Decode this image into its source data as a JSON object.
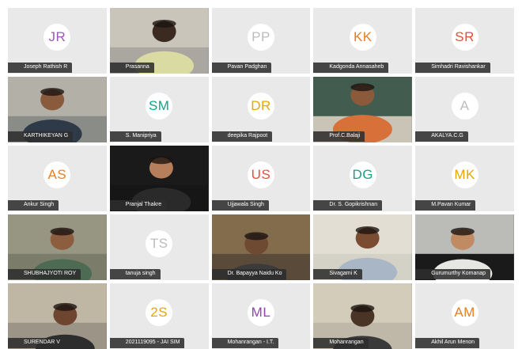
{
  "participants": [
    {
      "name": "Joseph Rathish R",
      "initials": "JR",
      "initials_color": "#9b59b6",
      "kind": "avatar"
    },
    {
      "name": "Prasanna",
      "kind": "video",
      "scene": "room-wall"
    },
    {
      "name": "Pavan Padghan",
      "initials": "PP",
      "initials_color": "#bcbcbc",
      "kind": "avatar"
    },
    {
      "name": "Kadgonda Annasaheb",
      "initials": "KK",
      "initials_color": "#e67e22",
      "kind": "avatar"
    },
    {
      "name": "Simhadri Ravishankar",
      "initials": "SR",
      "initials_color": "#e74c3c",
      "kind": "avatar"
    },
    {
      "name": "KARTHIKEYAN G",
      "kind": "video",
      "scene": "living-room"
    },
    {
      "name": "S. Manipriya",
      "initials": "SM",
      "initials_color": "#16a085",
      "kind": "avatar"
    },
    {
      "name": "deepika Rajpoot",
      "initials": "DR",
      "initials_color": "#e6a700",
      "kind": "avatar"
    },
    {
      "name": "Prof.C.Balaji",
      "kind": "video",
      "scene": "classroom"
    },
    {
      "name": "AKALYA.C.G",
      "initials": "A",
      "initials_color": "#bcbcbc",
      "kind": "avatar"
    },
    {
      "name": "Ankur Singh",
      "initials": "AS",
      "initials_color": "#e67e22",
      "kind": "avatar"
    },
    {
      "name": "Pranjal Thakre",
      "kind": "video",
      "scene": "dark"
    },
    {
      "name": "Ujjawala Singh",
      "initials": "US",
      "initials_color": "#e74c3c",
      "kind": "avatar"
    },
    {
      "name": "Dr. S. Gopikrishnan",
      "initials": "DG",
      "initials_color": "#16a085",
      "kind": "avatar"
    },
    {
      "name": "M.Pavan Kumar",
      "initials": "MK",
      "initials_color": "#e6a700",
      "kind": "avatar"
    },
    {
      "name": "SHUBHAJYOTI ROY",
      "kind": "video",
      "scene": "room-green"
    },
    {
      "name": "tanuja singh",
      "initials": "TS",
      "initials_color": "#bcbcbc",
      "kind": "avatar"
    },
    {
      "name": "Dr. Bapayya Naidu Ko",
      "kind": "video",
      "scene": "room-door"
    },
    {
      "name": "Sivagami K",
      "kind": "video",
      "scene": "bright"
    },
    {
      "name": "Gurumurthy Komanap",
      "kind": "video",
      "scene": "dark-portrait"
    },
    {
      "name": "SURENDAR V",
      "kind": "video",
      "scene": "room-beige"
    },
    {
      "name": "2021119095 - JAI SIM",
      "initials": "2S",
      "initials_color": "#e6a700",
      "kind": "avatar"
    },
    {
      "name": "Mohanrangan - I.T.",
      "initials": "ML",
      "initials_color": "#8e44ad",
      "kind": "avatar"
    },
    {
      "name": "Mohanrangan",
      "kind": "video",
      "scene": "office"
    },
    {
      "name": "Akhil Arun Menon",
      "initials": "AM",
      "initials_color": "#e67e22",
      "kind": "avatar"
    }
  ]
}
